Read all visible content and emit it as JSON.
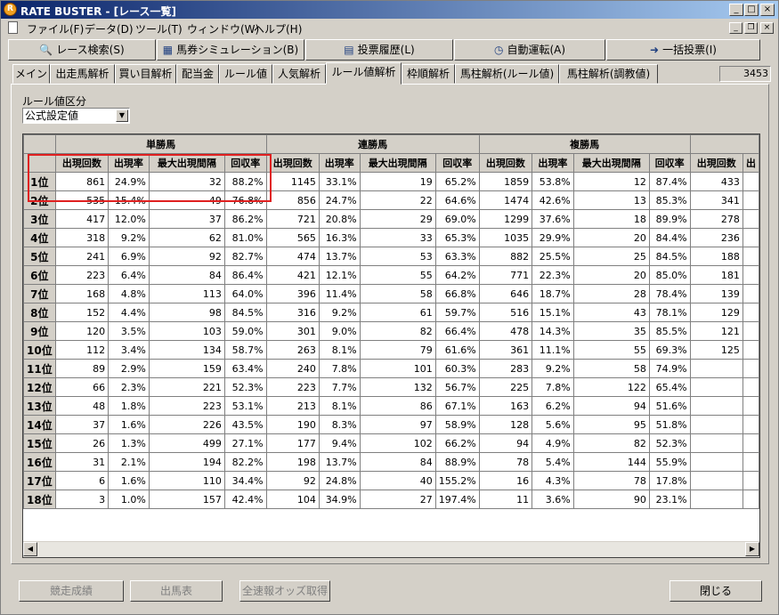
{
  "window": {
    "title": "RATE BUSTER - [レース一覧]",
    "app_icon_text": "R"
  },
  "menu": [
    "ファイル(F)",
    "データ(D)",
    "ツール(T)",
    "ウィンドウ(W)",
    "ヘルプ(H)"
  ],
  "toolbar": [
    {
      "label": "レース検索(S)",
      "icon": "search-icon"
    },
    {
      "label": "馬券シミュレーション(B)",
      "icon": "calculator-icon"
    },
    {
      "label": "投票履歴(L)",
      "icon": "history-icon"
    },
    {
      "label": "自動運転(A)",
      "icon": "clock-icon"
    },
    {
      "label": "一括投票(I)",
      "icon": "arrow-icon"
    }
  ],
  "tabs": [
    "メイン",
    "出走馬解析",
    "買い目解析",
    "配当金",
    "ルール値",
    "人気解析",
    "ルール値解析",
    "枠順解析",
    "馬柱解析(ルール値)",
    "馬柱解析(調教値)"
  ],
  "active_tab": "ルール値解析",
  "counter": "3453",
  "filter": {
    "label": "ルール値区分",
    "value": "公式設定値"
  },
  "groups": [
    "単勝馬",
    "連勝馬",
    "複勝馬"
  ],
  "columns": [
    "出現回数",
    "出現率",
    "最大出現間隔",
    "回収率"
  ],
  "partial_col": "出",
  "rows": [
    {
      "rank": "1位",
      "tan": [
        "861",
        "24.9%",
        "32",
        "88.2%"
      ],
      "ren": [
        "1145",
        "33.1%",
        "19",
        "65.2%"
      ],
      "fuku": [
        "1859",
        "53.8%",
        "12",
        "87.4%"
      ],
      "next": "433"
    },
    {
      "rank": "2位",
      "tan": [
        "535",
        "15.4%",
        "49",
        "76.8%"
      ],
      "ren": [
        "856",
        "24.7%",
        "22",
        "64.6%"
      ],
      "fuku": [
        "1474",
        "42.6%",
        "13",
        "85.3%"
      ],
      "next": "341"
    },
    {
      "rank": "3位",
      "tan": [
        "417",
        "12.0%",
        "37",
        "86.2%"
      ],
      "ren": [
        "721",
        "20.8%",
        "29",
        "69.0%"
      ],
      "fuku": [
        "1299",
        "37.6%",
        "18",
        "89.9%"
      ],
      "next": "278"
    },
    {
      "rank": "4位",
      "tan": [
        "318",
        "9.2%",
        "62",
        "81.0%"
      ],
      "ren": [
        "565",
        "16.3%",
        "33",
        "65.3%"
      ],
      "fuku": [
        "1035",
        "29.9%",
        "20",
        "84.4%"
      ],
      "next": "236"
    },
    {
      "rank": "5位",
      "tan": [
        "241",
        "6.9%",
        "92",
        "82.7%"
      ],
      "ren": [
        "474",
        "13.7%",
        "53",
        "63.3%"
      ],
      "fuku": [
        "882",
        "25.5%",
        "25",
        "84.5%"
      ],
      "next": "188"
    },
    {
      "rank": "6位",
      "tan": [
        "223",
        "6.4%",
        "84",
        "86.4%"
      ],
      "ren": [
        "421",
        "12.1%",
        "55",
        "64.2%"
      ],
      "fuku": [
        "771",
        "22.3%",
        "20",
        "85.0%"
      ],
      "next": "181"
    },
    {
      "rank": "7位",
      "tan": [
        "168",
        "4.8%",
        "113",
        "64.0%"
      ],
      "ren": [
        "396",
        "11.4%",
        "58",
        "66.8%"
      ],
      "fuku": [
        "646",
        "18.7%",
        "28",
        "78.4%"
      ],
      "next": "139"
    },
    {
      "rank": "8位",
      "tan": [
        "152",
        "4.4%",
        "98",
        "84.5%"
      ],
      "ren": [
        "316",
        "9.2%",
        "61",
        "59.7%"
      ],
      "fuku": [
        "516",
        "15.1%",
        "43",
        "78.1%"
      ],
      "next": "129"
    },
    {
      "rank": "9位",
      "tan": [
        "120",
        "3.5%",
        "103",
        "59.0%"
      ],
      "ren": [
        "301",
        "9.0%",
        "82",
        "66.4%"
      ],
      "fuku": [
        "478",
        "14.3%",
        "35",
        "85.5%"
      ],
      "next": "121"
    },
    {
      "rank": "10位",
      "tan": [
        "112",
        "3.4%",
        "134",
        "58.7%"
      ],
      "ren": [
        "263",
        "8.1%",
        "79",
        "61.6%"
      ],
      "fuku": [
        "361",
        "11.1%",
        "55",
        "69.3%"
      ],
      "next": "125"
    },
    {
      "rank": "11位",
      "tan": [
        "89",
        "2.9%",
        "159",
        "63.4%"
      ],
      "ren": [
        "240",
        "7.8%",
        "101",
        "60.3%"
      ],
      "fuku": [
        "283",
        "9.2%",
        "58",
        "74.9%"
      ],
      "next": ""
    },
    {
      "rank": "12位",
      "tan": [
        "66",
        "2.3%",
        "221",
        "52.3%"
      ],
      "ren": [
        "223",
        "7.7%",
        "132",
        "56.7%"
      ],
      "fuku": [
        "225",
        "7.8%",
        "122",
        "65.4%"
      ],
      "next": ""
    },
    {
      "rank": "13位",
      "tan": [
        "48",
        "1.8%",
        "223",
        "53.1%"
      ],
      "ren": [
        "213",
        "8.1%",
        "86",
        "67.1%"
      ],
      "fuku": [
        "163",
        "6.2%",
        "94",
        "51.6%"
      ],
      "next": ""
    },
    {
      "rank": "14位",
      "tan": [
        "37",
        "1.6%",
        "226",
        "43.5%"
      ],
      "ren": [
        "190",
        "8.3%",
        "97",
        "58.9%"
      ],
      "fuku": [
        "128",
        "5.6%",
        "95",
        "51.8%"
      ],
      "next": ""
    },
    {
      "rank": "15位",
      "tan": [
        "26",
        "1.3%",
        "499",
        "27.1%"
      ],
      "ren": [
        "177",
        "9.4%",
        "102",
        "66.2%"
      ],
      "fuku": [
        "94",
        "4.9%",
        "82",
        "52.3%"
      ],
      "next": ""
    },
    {
      "rank": "16位",
      "tan": [
        "31",
        "2.1%",
        "194",
        "82.2%"
      ],
      "ren": [
        "198",
        "13.7%",
        "84",
        "88.9%"
      ],
      "fuku": [
        "78",
        "5.4%",
        "144",
        "55.9%"
      ],
      "next": ""
    },
    {
      "rank": "17位",
      "tan": [
        "6",
        "1.6%",
        "110",
        "34.4%"
      ],
      "ren": [
        "92",
        "24.8%",
        "40",
        "155.2%"
      ],
      "fuku": [
        "16",
        "4.3%",
        "78",
        "17.8%"
      ],
      "next": ""
    },
    {
      "rank": "18位",
      "tan": [
        "3",
        "1.0%",
        "157",
        "42.4%"
      ],
      "ren": [
        "104",
        "34.9%",
        "27",
        "197.4%"
      ],
      "fuku": [
        "11",
        "3.6%",
        "90",
        "23.1%"
      ],
      "next": ""
    }
  ],
  "footer": {
    "race_results": "競走成績",
    "entry_table": "出馬表",
    "fetch_odds": "全速報オッズ取得",
    "close": "閉じる"
  },
  "colors": {
    "title_start": "#0a246a",
    "title_end": "#a6caf0",
    "highlight": "#e02020"
  }
}
